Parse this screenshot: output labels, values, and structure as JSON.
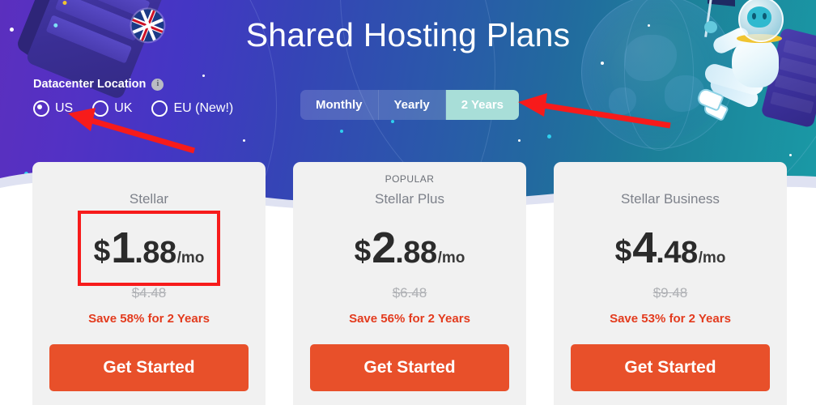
{
  "page": {
    "title": "Shared Hosting Plans"
  },
  "datacenter": {
    "label": "Datacenter Location",
    "info_icon": "info-icon",
    "options": [
      {
        "label": "US",
        "selected": true
      },
      {
        "label": "UK",
        "selected": false
      },
      {
        "label": "EU (New!)",
        "selected": false
      }
    ]
  },
  "billing_tabs": {
    "items": [
      {
        "label": "Monthly",
        "active": false
      },
      {
        "label": "Yearly",
        "active": false
      },
      {
        "label": "2 Years",
        "active": true
      }
    ]
  },
  "plans": [
    {
      "badge": "",
      "name": "Stellar",
      "currency": "$",
      "price_whole": "1",
      "price_frac": ".88",
      "per": "/mo",
      "old_price": "$4.48",
      "save_text": "Save 58% for 2 Years",
      "cta_label": "Get Started",
      "highlighted": true
    },
    {
      "badge": "POPULAR",
      "name": "Stellar Plus",
      "currency": "$",
      "price_whole": "2",
      "price_frac": ".88",
      "per": "/mo",
      "old_price": "$6.48",
      "save_text": "Save 56% for 2 Years",
      "cta_label": "Get Started",
      "highlighted": false
    },
    {
      "badge": "",
      "name": "Stellar Business",
      "currency": "$",
      "price_whole": "4",
      "price_frac": ".48",
      "per": "/mo",
      "old_price": "$9.48",
      "save_text": "Save 53% for 2 Years",
      "cta_label": "Get Started",
      "highlighted": false
    }
  ],
  "colors": {
    "hero_start": "#5b2fbe",
    "hero_end": "#1a9aa6",
    "cta": "#e8502a",
    "save_text": "#e33b1e",
    "annotation": "#f71b1b",
    "active_tab": "#a8ded8",
    "card_bg": "#f1f1f1"
  },
  "annotations": {
    "arrow_to_us_radio": "red-arrow",
    "arrow_to_two_years_tab": "red-arrow",
    "price_highlight_box": "red-rectangle"
  },
  "decor": {
    "mascot": "yeti-astronaut",
    "server_rack_left": "server-rack",
    "server_rack_right": "server-rack",
    "uk_flag_badge": "uk-flag-icon",
    "globe": "globe-illustration"
  }
}
